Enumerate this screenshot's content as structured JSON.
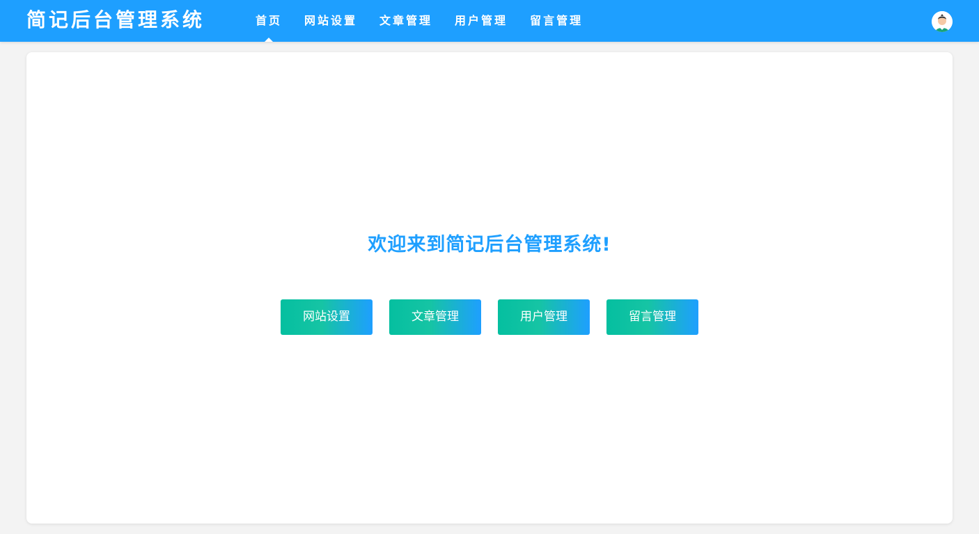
{
  "header": {
    "brand": "简记后台管理系统",
    "nav": [
      {
        "label": "首页",
        "active": true
      },
      {
        "label": "网站设置",
        "active": false
      },
      {
        "label": "文章管理",
        "active": false
      },
      {
        "label": "用户管理",
        "active": false
      },
      {
        "label": "留言管理",
        "active": false
      }
    ],
    "avatar_icon": "user-avatar-icon"
  },
  "main": {
    "welcome": "欢迎来到简记后台管理系统!",
    "quick_links": [
      {
        "label": "网站设置"
      },
      {
        "label": "文章管理"
      },
      {
        "label": "用户管理"
      },
      {
        "label": "留言管理"
      }
    ]
  },
  "colors": {
    "primary": "#1e9fff",
    "accent": "#05bfa0",
    "background": "#f3f3f3"
  }
}
